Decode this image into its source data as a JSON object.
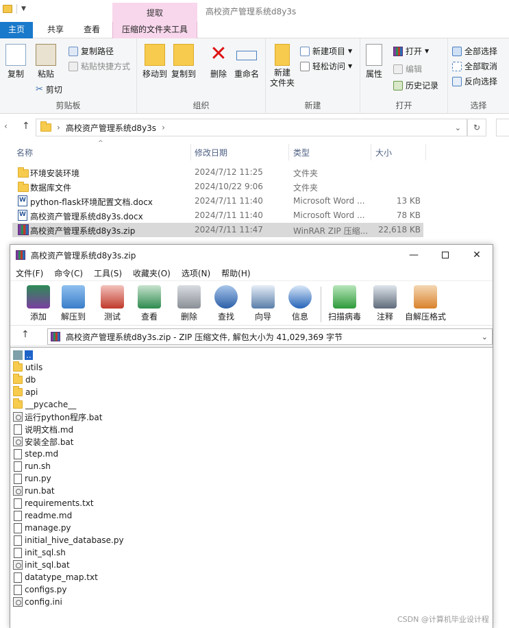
{
  "explorer": {
    "title": "高校资产管理系统d8y3s",
    "context_header": "提取",
    "tabs": {
      "home": "主页",
      "share": "共享",
      "view": "查看",
      "tools": "压缩的文件夹工具"
    },
    "ribbon": {
      "clipboard": {
        "label": "剪贴板",
        "copy": "复制",
        "paste": "粘贴",
        "copy_path": "复制路径",
        "paste_shortcut": "粘贴快捷方式",
        "cut": "剪切"
      },
      "organize": {
        "label": "组织",
        "move_to": "移动到",
        "copy_to": "复制到",
        "delete": "删除",
        "rename": "重命名"
      },
      "new": {
        "label": "新建",
        "new_folder": "新建\n文件夹",
        "new_item": "新建项目",
        "easy_access": "轻松访问"
      },
      "open": {
        "label": "打开",
        "properties": "属性",
        "open": "打开",
        "edit": "编辑",
        "history": "历史记录"
      },
      "select": {
        "label": "选择",
        "select_all": "全部选择",
        "select_none": "全部取消",
        "invert": "反向选择"
      }
    },
    "address": {
      "path": "高校资产管理系统d8y3s",
      "refresh_icon": "refresh-icon"
    },
    "columns": {
      "name": "名称",
      "date": "修改日期",
      "type": "类型",
      "size": "大小"
    },
    "files": [
      {
        "name": "环境安装环境",
        "date": "2024/7/12 11:25",
        "type": "文件夹",
        "size": "",
        "kind": "folder"
      },
      {
        "name": "数据库文件",
        "date": "2024/10/22 9:06",
        "type": "文件夹",
        "size": "",
        "kind": "folder"
      },
      {
        "name": "python-flask环境配置文档.docx",
        "date": "2024/7/11 11:40",
        "type": "Microsoft Word ...",
        "size": "13 KB",
        "kind": "docx"
      },
      {
        "name": "高校资产管理系统d8y3s.docx",
        "date": "2024/7/11 11:40",
        "type": "Microsoft Word ...",
        "size": "78 KB",
        "kind": "docx"
      },
      {
        "name": "高校资产管理系统d8y3s.zip",
        "date": "2024/7/11 11:47",
        "type": "WinRAR ZIP 压缩...",
        "size": "22,618 KB",
        "kind": "zip"
      }
    ]
  },
  "winrar": {
    "title": "高校资产管理系统d8y3s.zip",
    "menu": [
      "文件(F)",
      "命令(C)",
      "工具(S)",
      "收藏夹(O)",
      "选项(N)",
      "帮助(H)"
    ],
    "toolbar": [
      "添加",
      "解压到",
      "测试",
      "查看",
      "删除",
      "查找",
      "向导",
      "信息",
      "扫描病毒",
      "注释",
      "自解压格式"
    ],
    "address": "高校资产管理系统d8y3s.zip - ZIP 压缩文件, 解包大小为 41,029,369 字节",
    "items": [
      {
        "name": "..",
        "kind": "up"
      },
      {
        "name": "utils",
        "kind": "folder"
      },
      {
        "name": "db",
        "kind": "folder"
      },
      {
        "name": "api",
        "kind": "folder"
      },
      {
        "name": "__pycache__",
        "kind": "folder"
      },
      {
        "name": "运行python程序.bat",
        "kind": "bat"
      },
      {
        "name": "说明文档.md",
        "kind": "file"
      },
      {
        "name": "安装全部.bat",
        "kind": "bat"
      },
      {
        "name": "step.md",
        "kind": "file"
      },
      {
        "name": "run.sh",
        "kind": "file"
      },
      {
        "name": "run.py",
        "kind": "file"
      },
      {
        "name": "run.bat",
        "kind": "bat"
      },
      {
        "name": "requirements.txt",
        "kind": "file"
      },
      {
        "name": "readme.md",
        "kind": "file"
      },
      {
        "name": "manage.py",
        "kind": "file"
      },
      {
        "name": "initial_hive_database.py",
        "kind": "file"
      },
      {
        "name": "init_sql.sh",
        "kind": "file"
      },
      {
        "name": "init_sql.bat",
        "kind": "bat"
      },
      {
        "name": "datatype_map.txt",
        "kind": "file"
      },
      {
        "name": "configs.py",
        "kind": "file"
      },
      {
        "name": "config.ini",
        "kind": "bat"
      }
    ]
  },
  "watermark": "CSDN @计算机毕业设计程"
}
